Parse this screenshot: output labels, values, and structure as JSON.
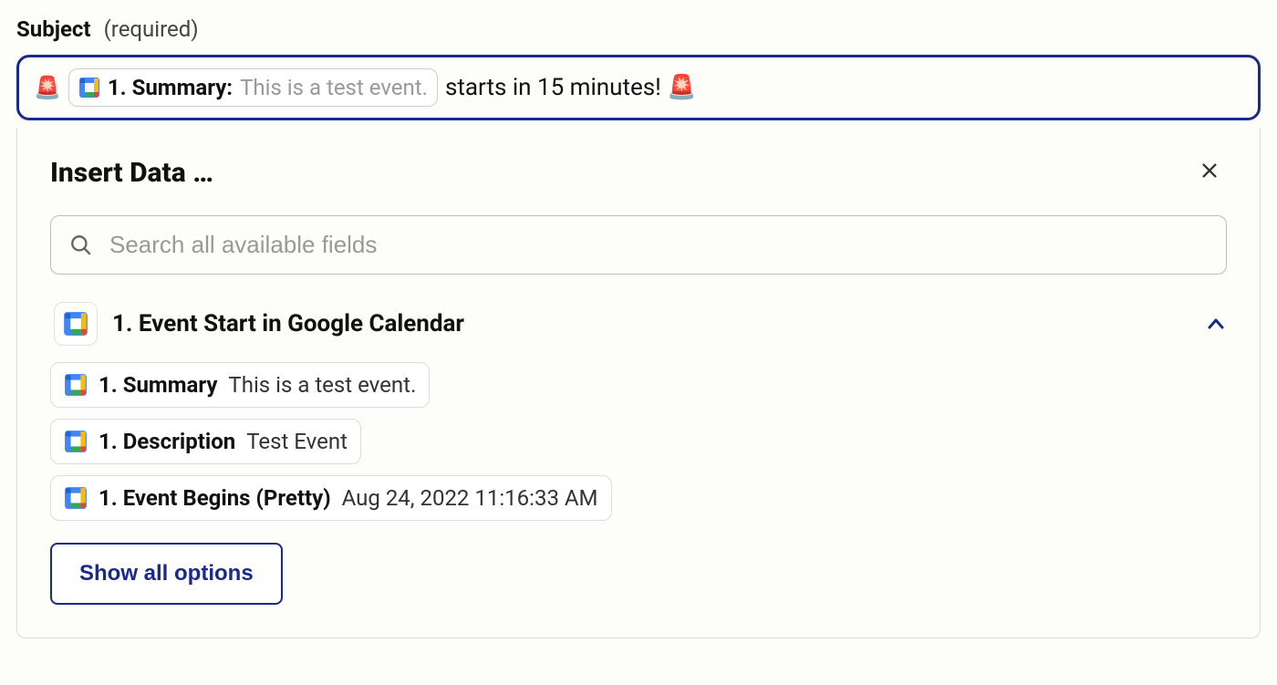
{
  "subject": {
    "label": "Subject",
    "required_text": "(required)",
    "leading_emoji": "🚨",
    "pill": {
      "label": "1. Summary:",
      "value": "This is a test event."
    },
    "tail_text": " starts in 15 minutes! 🚨"
  },
  "panel": {
    "title": "Insert Data …"
  },
  "search": {
    "placeholder": "Search all available fields"
  },
  "source": {
    "title": "1. Event Start in Google Calendar"
  },
  "fields": [
    {
      "name": "1. Summary",
      "value": "This is a test event."
    },
    {
      "name": "1. Description",
      "value": "Test Event"
    },
    {
      "name": "1. Event Begins (Pretty)",
      "value": "Aug 24, 2022 11:16:33 AM"
    }
  ],
  "show_all_label": "Show all options"
}
